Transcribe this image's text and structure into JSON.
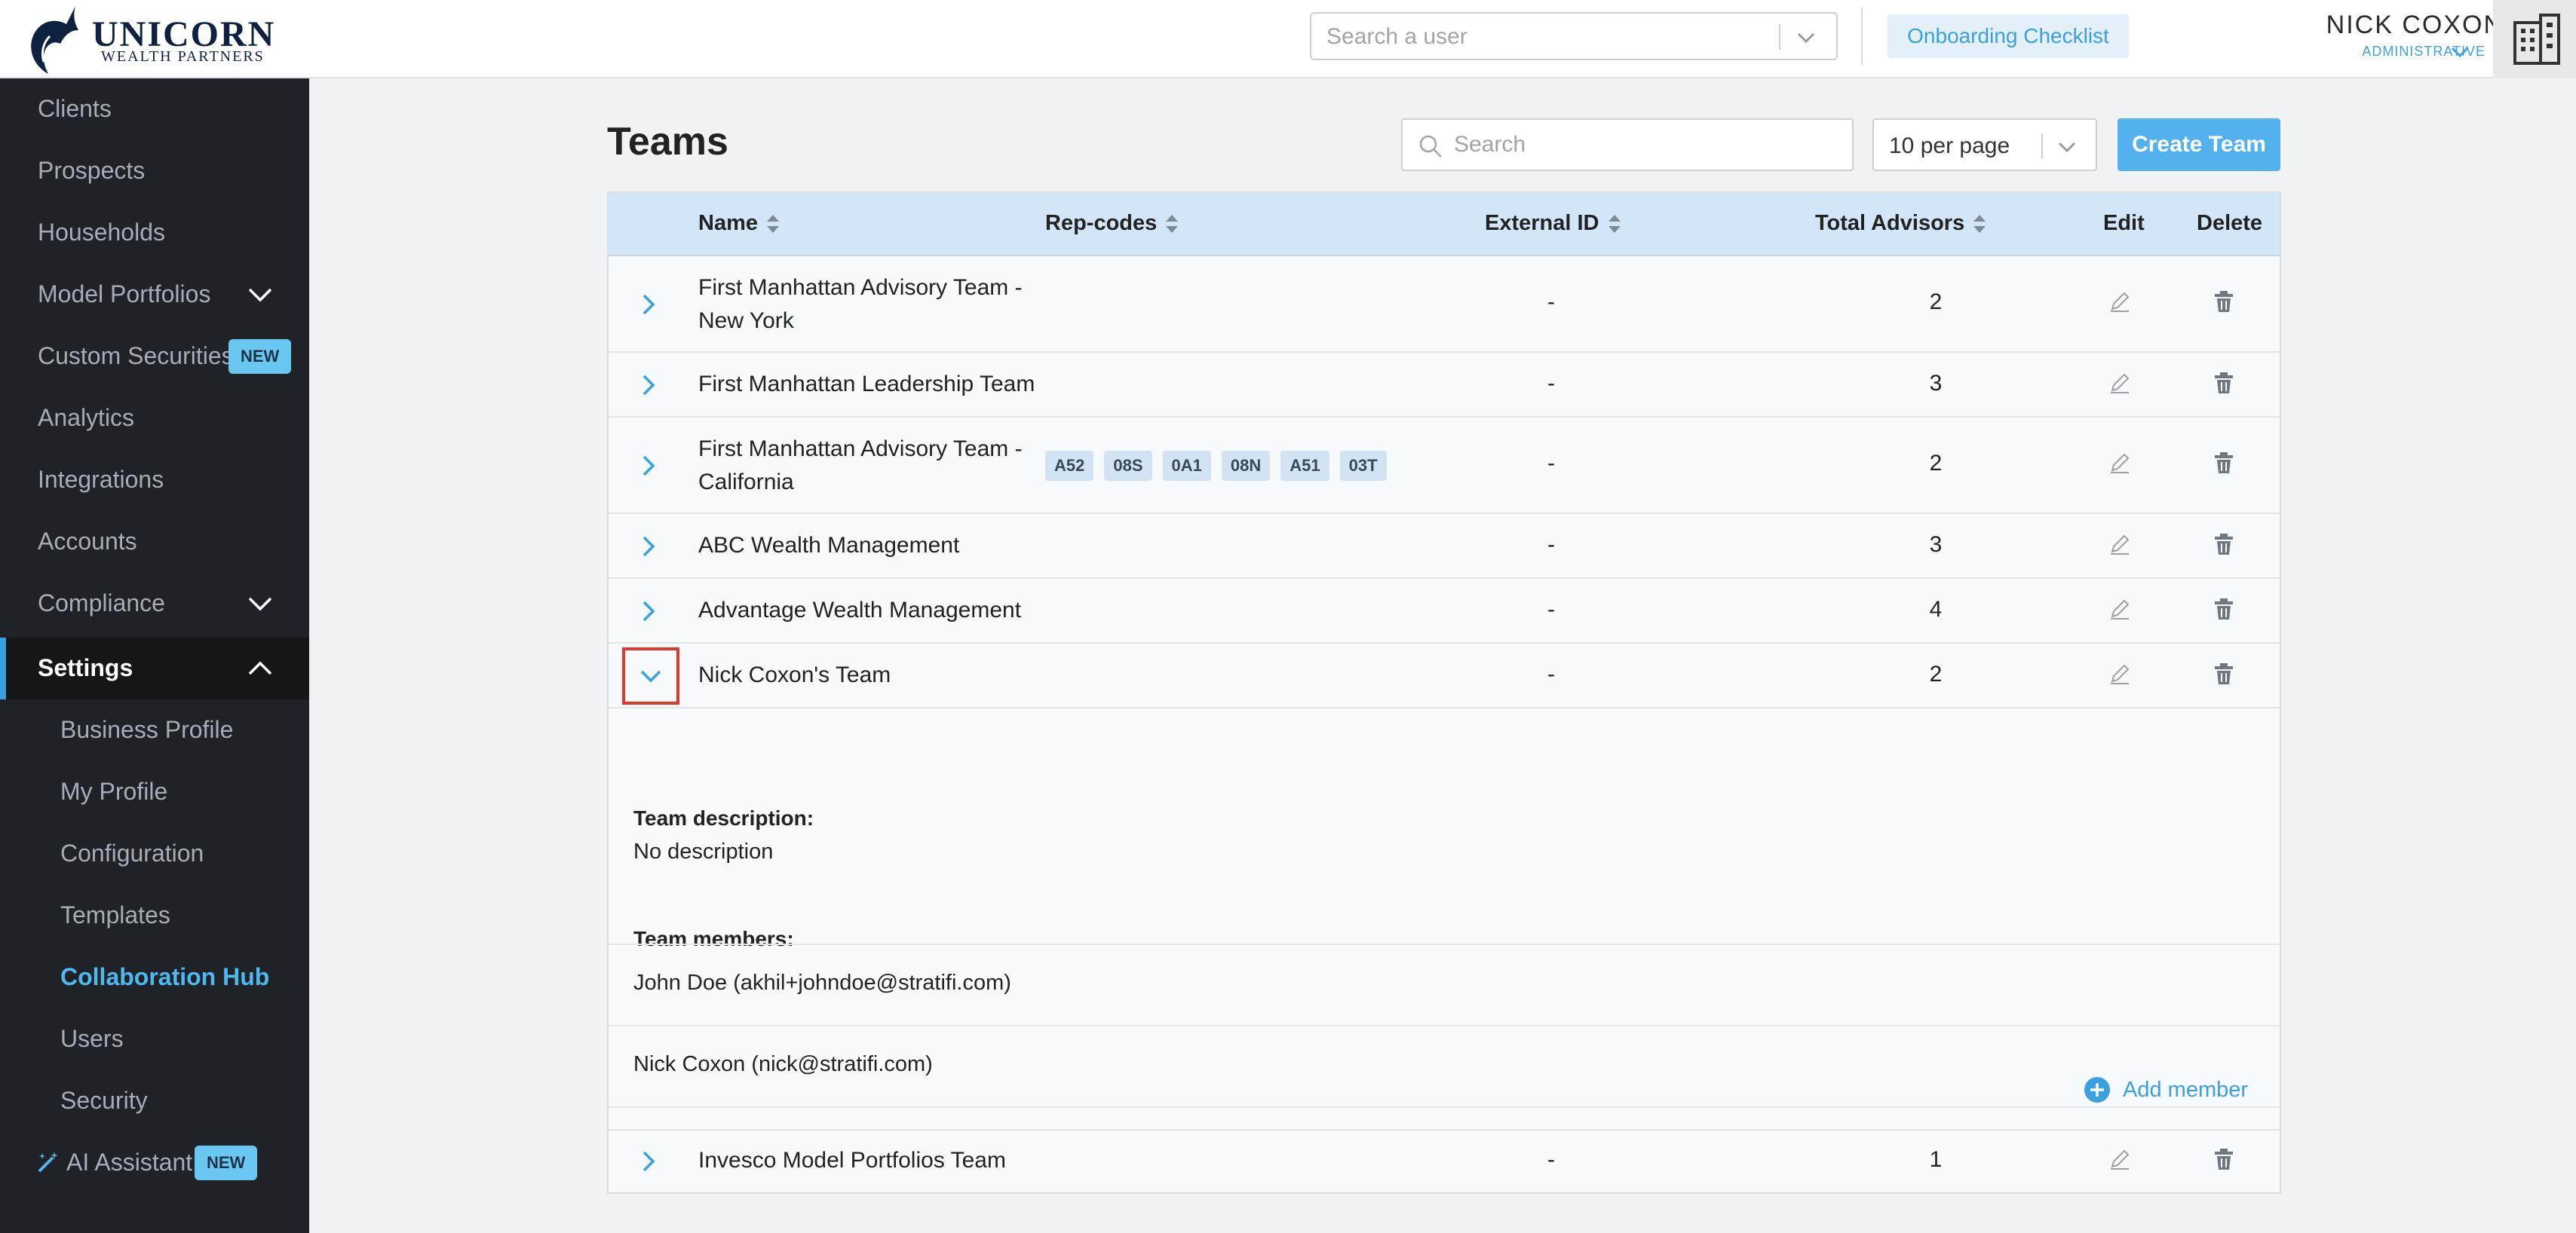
{
  "brand": {
    "title": "UNICORN",
    "subtitle": "WEALTH PARTNERS"
  },
  "header": {
    "user_search_placeholder": "Search a user",
    "onboarding_label": "Onboarding Checklist",
    "user_name": "NICK COXON",
    "user_role": "ADMINISTRATIVE"
  },
  "sidebar": {
    "items": [
      {
        "label": "Clients"
      },
      {
        "label": "Prospects"
      },
      {
        "label": "Households"
      },
      {
        "label": "Model Portfolios"
      },
      {
        "label": "Custom Securities",
        "badge": "NEW"
      },
      {
        "label": "Analytics"
      },
      {
        "label": "Integrations"
      },
      {
        "label": "Accounts"
      },
      {
        "label": "Compliance"
      },
      {
        "label": "Settings"
      },
      {
        "label": "Business Profile"
      },
      {
        "label": "My Profile"
      },
      {
        "label": "Configuration"
      },
      {
        "label": "Templates"
      },
      {
        "label": "Collaboration Hub"
      },
      {
        "label": "Users"
      },
      {
        "label": "Security"
      },
      {
        "label": "AI Assistant",
        "badge": "NEW"
      }
    ]
  },
  "page": {
    "title": "Teams",
    "search_placeholder": "Search",
    "per_page": "10 per page",
    "create_label": "Create Team"
  },
  "table": {
    "columns": {
      "name": "Name",
      "repcodes": "Rep-codes",
      "external_id": "External ID",
      "total_advisors": "Total Advisors",
      "edit": "Edit",
      "delete": "Delete"
    },
    "rows": [
      {
        "name": "First Manhattan Advisory Team - New York",
        "repcodes": [],
        "external_id": "-",
        "total_advisors": "2"
      },
      {
        "name": "First Manhattan Leadership Team",
        "repcodes": [],
        "external_id": "-",
        "total_advisors": "3"
      },
      {
        "name": "First Manhattan Advisory Team - California",
        "repcodes": [
          "A52",
          "08S",
          "0A1",
          "08N",
          "A51",
          "03T"
        ],
        "external_id": "-",
        "total_advisors": "2"
      },
      {
        "name": "ABC Wealth Management",
        "repcodes": [],
        "external_id": "-",
        "total_advisors": "3"
      },
      {
        "name": "Advantage Wealth Management",
        "repcodes": [],
        "external_id": "-",
        "total_advisors": "4"
      },
      {
        "name": "Nick Coxon's Team",
        "repcodes": [],
        "external_id": "-",
        "total_advisors": "2",
        "expanded": true
      },
      {
        "name": "Invesco Model Portfolios Team",
        "repcodes": [],
        "external_id": "-",
        "total_advisors": "1"
      }
    ],
    "detail": {
      "description_label": "Team description:",
      "description": "No description",
      "members_label": "Team members:",
      "members": [
        "John Doe (akhil+johndoe@stratifi.com)",
        "Nick Coxon (nick@stratifi.com)"
      ],
      "add_member_label": "Add member"
    }
  },
  "colors": {
    "accent": "#3aa0e0",
    "sidebar_bg": "#1f2327",
    "header_row_bg": "#d2e6f7",
    "highlight_border": "#e2382b",
    "badge_bg": "#6ac7f2"
  },
  "icons": [
    "unicorn-logo",
    "chevron-down-icon",
    "building-icon",
    "search-icon",
    "sort-icon",
    "chevron-right-icon",
    "pencil-icon",
    "trash-icon",
    "plus-circle-icon",
    "magic-wand-icon"
  ]
}
